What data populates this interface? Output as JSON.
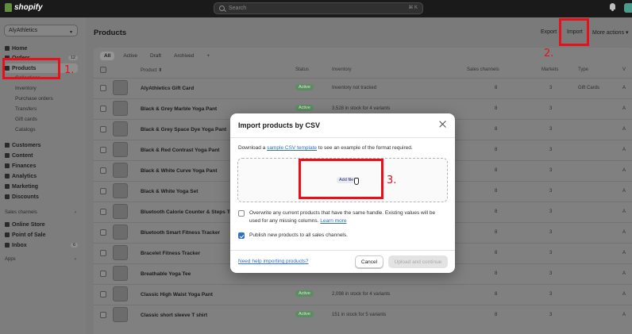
{
  "topbar": {
    "brand": "shopify",
    "search_placeholder": "Search",
    "search_shortcut": "⌘ K"
  },
  "sidebar": {
    "store": "AlyAthletics",
    "items": [
      {
        "label": "Home",
        "icon": "home-icon"
      },
      {
        "label": "Orders",
        "icon": "orders-icon",
        "count": "12"
      },
      {
        "label": "Products",
        "icon": "tag-icon",
        "active": true
      },
      {
        "label": "Customers",
        "icon": "person-icon"
      },
      {
        "label": "Content",
        "icon": "content-icon"
      },
      {
        "label": "Finances",
        "icon": "bank-icon"
      },
      {
        "label": "Analytics",
        "icon": "chart-icon"
      },
      {
        "label": "Marketing",
        "icon": "target-icon"
      },
      {
        "label": "Discounts",
        "icon": "discount-icon"
      }
    ],
    "product_sub": [
      "Collections",
      "Inventory",
      "Purchase orders",
      "Transfers",
      "Gift cards",
      "Catalogs"
    ],
    "sales_channels_label": "Sales channels",
    "channels": [
      {
        "label": "Online Store",
        "icon": "store-icon"
      },
      {
        "label": "Point of Sale",
        "icon": "pos-icon"
      },
      {
        "label": "Inbox",
        "icon": "inbox-icon",
        "count": "6"
      }
    ],
    "apps_label": "Apps"
  },
  "main": {
    "title": "Products",
    "export_label": "Export",
    "import_label": "Import",
    "more_actions_label": "More actions",
    "tabs": [
      "All",
      "Active",
      "Draft",
      "Archived",
      "+"
    ],
    "columns": {
      "product": "Product",
      "status": "Status",
      "inventory": "Inventory",
      "sales_channels": "Sales channels",
      "markets": "Markets",
      "type": "Type",
      "vendor": "V"
    },
    "rows": [
      {
        "name": "AlyAthletics Gift Card",
        "status": "Active",
        "inventory": "Inventory not tracked",
        "channels": "8",
        "markets": "3",
        "type": "Gift Cards",
        "vendor": "A"
      },
      {
        "name": "Black & Grey Marble Yoga Pant",
        "status": "Active",
        "inventory": "3,528 in stock for 4 variants",
        "channels": "8",
        "markets": "3",
        "type": "",
        "vendor": "A"
      },
      {
        "name": "Black & Grey Space Dye Yoga Pant",
        "status": "",
        "inventory": "",
        "channels": "8",
        "markets": "3",
        "type": "",
        "vendor": "A"
      },
      {
        "name": "Black & Red Contrast Yoga Pant",
        "status": "",
        "inventory": "",
        "channels": "8",
        "markets": "3",
        "type": "",
        "vendor": "A"
      },
      {
        "name": "Black & White Curve Yoga Pant",
        "status": "",
        "inventory": "",
        "channels": "8",
        "markets": "3",
        "type": "",
        "vendor": "A"
      },
      {
        "name": "Black & White Yoga Set",
        "status": "",
        "inventory": "",
        "channels": "8",
        "markets": "3",
        "type": "",
        "vendor": "A"
      },
      {
        "name": "Bluetooth Calorie Counter & Steps Tr",
        "status": "",
        "inventory": "",
        "channels": "8",
        "markets": "3",
        "type": "",
        "vendor": "A"
      },
      {
        "name": "Bluetooth Smart Fitness Tracker",
        "status": "",
        "inventory": "",
        "channels": "8",
        "markets": "3",
        "type": "",
        "vendor": "A"
      },
      {
        "name": "Bracelet Fitness Tracker",
        "status": "",
        "inventory": "",
        "channels": "8",
        "markets": "3",
        "type": "",
        "vendor": "A"
      },
      {
        "name": "Breathable Yoga Tee",
        "status": "",
        "inventory": "",
        "channels": "8",
        "markets": "3",
        "type": "",
        "vendor": "A"
      },
      {
        "name": "Classic High Waist Yoga Pant",
        "status": "Active",
        "inventory": "2,098 in stock for 4 variants",
        "channels": "8",
        "markets": "3",
        "type": "",
        "vendor": "A"
      },
      {
        "name": "Classic short sleeve T shirt",
        "status": "Active",
        "inventory": "151 in stock for 5 variants",
        "channels": "8",
        "markets": "3",
        "type": "",
        "vendor": "A"
      }
    ]
  },
  "modal": {
    "title": "Import products by CSV",
    "desc_pre": "Download a ",
    "desc_link": "sample CSV template",
    "desc_post": " to see an example of the format required.",
    "add_file_label": "Add file",
    "overwrite_label": "Overwrite any current products that have the same handle. Existing values will be used for any missing columns. ",
    "learn_more": "Learn more",
    "publish_label": "Publish new products to all sales channels.",
    "help_link": "Need help importing products?",
    "cancel_label": "Cancel",
    "upload_label": "Upload and continue"
  },
  "annotations": [
    "1.",
    "2.",
    "3."
  ],
  "colors": {
    "annotation": "#e8101a",
    "link": "#2c6ecb",
    "active_badge": "#5a8d5f"
  }
}
